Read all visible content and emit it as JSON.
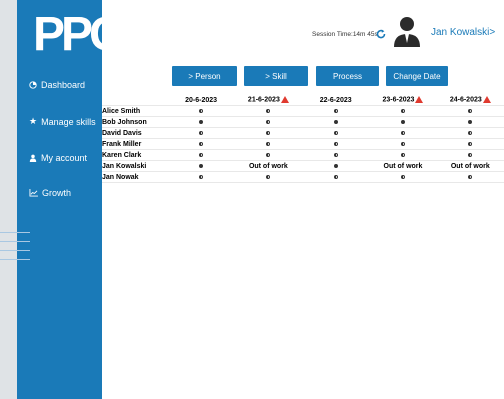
{
  "brand": {
    "logo_text": "PPG",
    "accent": "#1a7ab8"
  },
  "sidebar": {
    "items": [
      {
        "label": "Dashboard",
        "icon": "clock-icon"
      },
      {
        "label": "Manage skills",
        "icon": "star-icon"
      },
      {
        "label": "My account",
        "icon": "user-icon"
      },
      {
        "label": "Growth",
        "icon": "chart-icon"
      }
    ]
  },
  "header": {
    "session_text": "Session Time:14m 45s",
    "user_name": "Jan Kowalski>"
  },
  "toolbar": {
    "person_label": "> Person",
    "skill_label": "> Skill",
    "process_label": "Process",
    "change_date_label": "Change Date"
  },
  "schedule": {
    "dates": [
      {
        "label": "20-6-2023",
        "warning": false
      },
      {
        "label": "21-6-2023",
        "warning": true
      },
      {
        "label": "22-6-2023",
        "warning": false
      },
      {
        "label": "23-6-2023",
        "warning": true
      },
      {
        "label": "24-6-2023",
        "warning": true
      }
    ],
    "rows": [
      {
        "name": "Alice Smith",
        "cells": [
          "half",
          "half",
          "half",
          "half",
          "half"
        ]
      },
      {
        "name": "Bob Johnson",
        "cells": [
          "full",
          "half",
          "full",
          "full",
          "full"
        ]
      },
      {
        "name": "David Davis",
        "cells": [
          "half",
          "half",
          "half",
          "half",
          "half"
        ]
      },
      {
        "name": "Frank Miller",
        "cells": [
          "half",
          "half",
          "half",
          "half",
          "half"
        ]
      },
      {
        "name": "Karen Clark",
        "cells": [
          "half",
          "half",
          "half",
          "half",
          "half"
        ]
      },
      {
        "name": "Jan Kowalski",
        "cells": [
          "full",
          "Out of work",
          "full",
          "Out of work",
          "Out of work"
        ]
      },
      {
        "name": "Jan Nowak",
        "cells": [
          "half",
          "half",
          "half",
          "half",
          "half"
        ]
      }
    ]
  }
}
